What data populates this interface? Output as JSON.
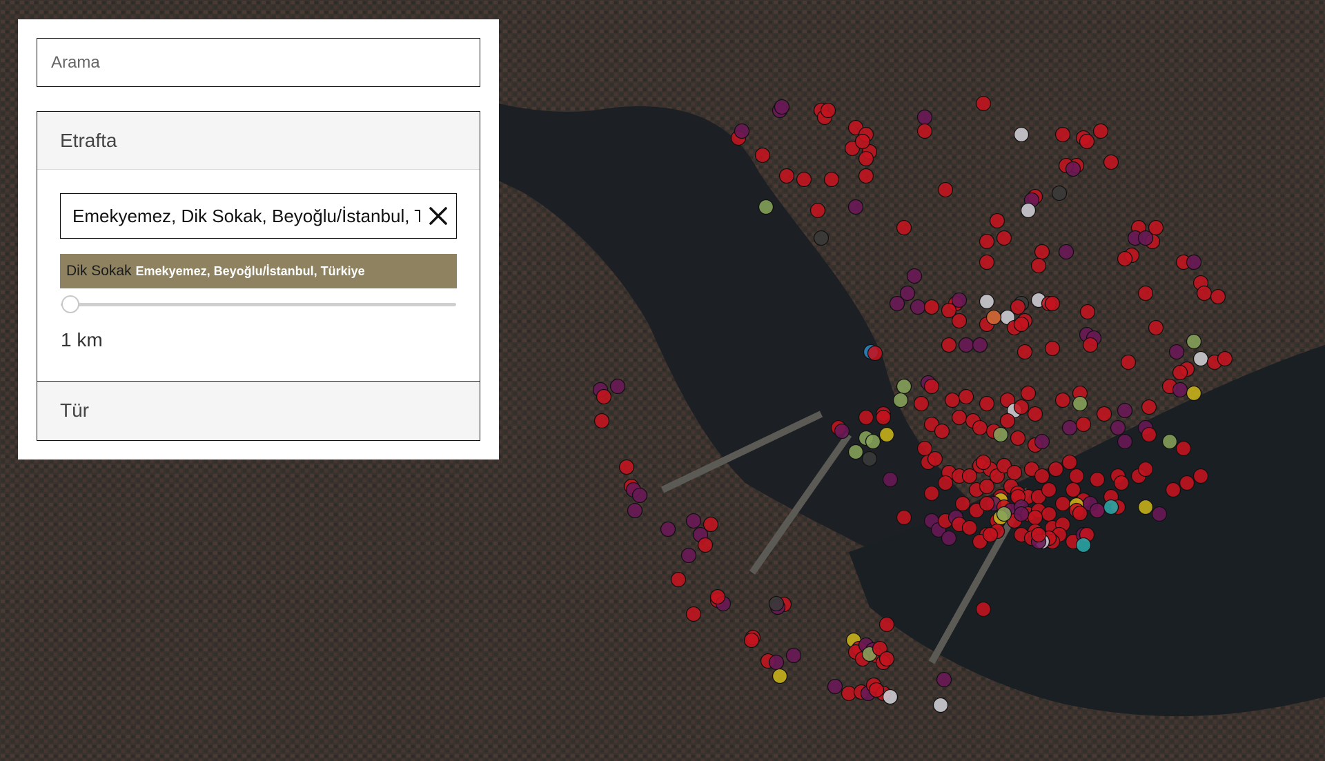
{
  "search": {
    "placeholder": "Arama"
  },
  "near": {
    "title": "Etrafta",
    "address_value": "Emekyemez, Dik Sokak, Beyoğlu/İstanbul, Türkiye",
    "clear_icon": "close-icon",
    "suggestion": {
      "main": "Dik Sokak",
      "secondary": "Emekyemez, Beyoğlu/İstanbul, Türkiye"
    },
    "radius": {
      "value_km": 1,
      "label": "1 km"
    }
  },
  "type_section": {
    "title": "Tür"
  },
  "colors": {
    "red": "#c4131f",
    "purple": "#6a1857",
    "olive": "#86a35a",
    "yellow": "#c9b41a",
    "gray": "#cfcfd6",
    "dark": "#3a3a3a",
    "orange": "#d86a36",
    "teal": "#2aa7a7",
    "blue": "#2e86c1",
    "accent": "#8e8260"
  }
}
